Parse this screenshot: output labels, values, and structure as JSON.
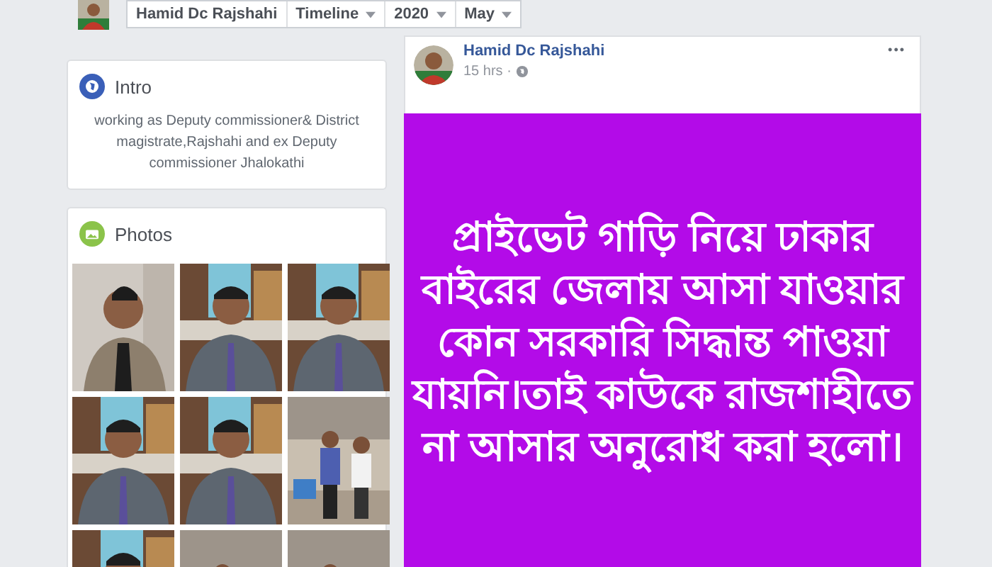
{
  "top_bar": {
    "items": [
      {
        "label": "Hamid Dc Rajshahi",
        "kind": "name"
      },
      {
        "label": "Timeline",
        "kind": "dropdown"
      },
      {
        "label": "2020",
        "kind": "dropdown"
      },
      {
        "label": "May",
        "kind": "dropdown"
      }
    ]
  },
  "intro": {
    "title": "Intro",
    "text": "working as Deputy commissioner& District magistrate,Rajshahi and ex Deputy commissioner Jhalokathi"
  },
  "photos": {
    "title": "Photos"
  },
  "post": {
    "author": "Hamid Dc Rajshahi",
    "time": "15 hrs ·",
    "menu": "•••",
    "text": "প্রাইভেট গাড়ি নিয়ে ঢাকার\nবাইরের জেলায় আসা যাওয়ার\nকোন সরকারি সিদ্ধান্ত পাওয়া\nযায়নি।তাই কাউকে রাজশাহীতে\nনা আসার অনুরোধ করা হলো।"
  }
}
